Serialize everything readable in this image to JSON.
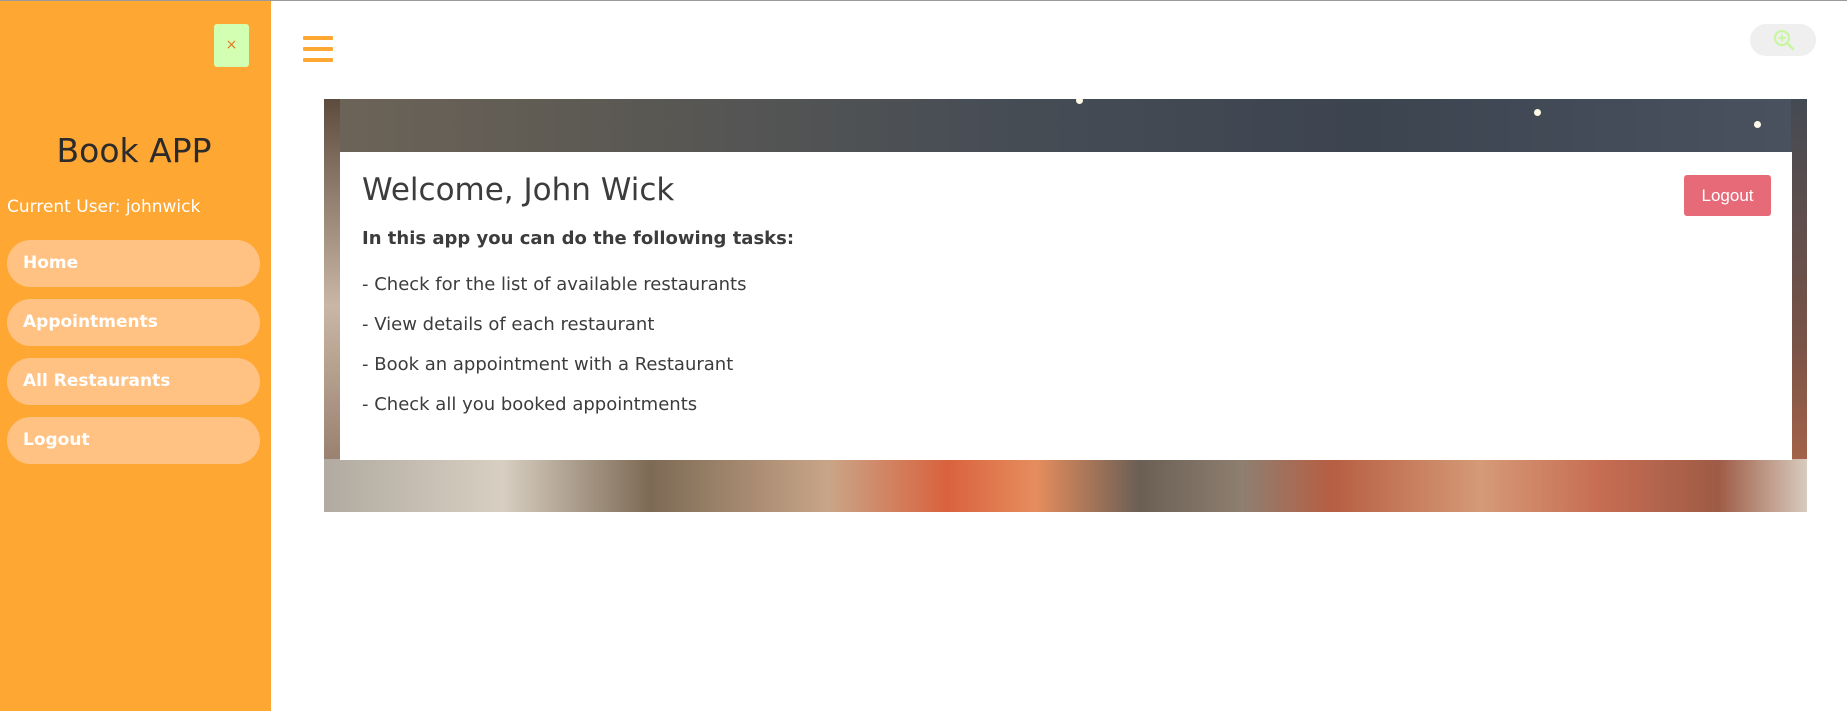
{
  "sidebar": {
    "close_label": "×",
    "title": "Book APP",
    "current_user": "Current User: johnwick",
    "nav": [
      {
        "label": "Home"
      },
      {
        "label": "Appointments"
      },
      {
        "label": "All Restaurants"
      },
      {
        "label": "Logout"
      }
    ]
  },
  "topbar": {
    "menu_icon": "hamburger-icon",
    "zoom_icon": "zoom-in-icon"
  },
  "main": {
    "welcome": "Welcome, John Wick",
    "tasks_heading": "In this app you can do the following tasks:",
    "tasks": [
      "- Check for the list of available restaurants",
      "- View details of each restaurant",
      "- Book an appointment with a Restaurant",
      "- Check all you booked appointments"
    ],
    "logout_label": "Logout"
  },
  "colors": {
    "sidebar": "#ffa733",
    "nav_item": "#ffc283",
    "close_button": "#d3ffb2",
    "logout_button": "#e66a78",
    "text": "#3c3c3c"
  }
}
